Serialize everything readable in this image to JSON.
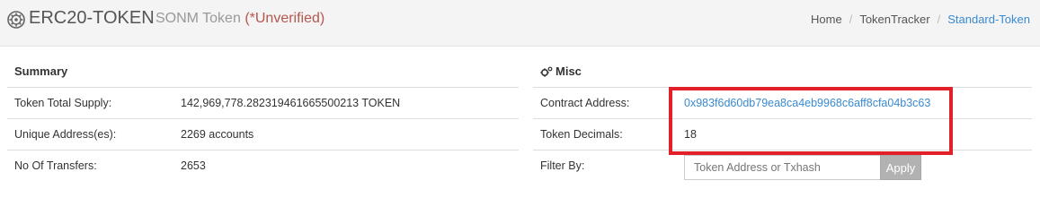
{
  "header": {
    "title": "ERC20-TOKEN",
    "token_name": "SONM Token",
    "unverified": "(*Unverified)",
    "brand_icon": "gear-emblem-icon"
  },
  "breadcrumb": {
    "items": [
      "Home",
      "TokenTracker",
      "Standard-Token"
    ],
    "separator": "/"
  },
  "summary": {
    "heading": "Summary",
    "rows": [
      {
        "label": "Token Total Supply:",
        "value": "142,969,778.282319461665500213 TOKEN"
      },
      {
        "label": "Unique Address(es):",
        "value": "2269 accounts"
      },
      {
        "label": "No Of Transfers:",
        "value": "2653"
      }
    ]
  },
  "misc": {
    "heading": "Misc",
    "heading_icon": "cogs-icon",
    "contract_label": "Contract Address:",
    "contract_value": "0x983f6d60db79ea8ca4eb9968c6aff8cfa04b3c63",
    "decimals_label": "Token Decimals:",
    "decimals_value": "18",
    "filter_label": "Filter By:",
    "filter_placeholder": "Token Address or Txhash",
    "apply_label": "Apply"
  },
  "colors": {
    "link": "#3a8ad1",
    "unverified": "#b5564e",
    "highlight": "#e0202a",
    "apply_button": "#b2b2b2"
  }
}
